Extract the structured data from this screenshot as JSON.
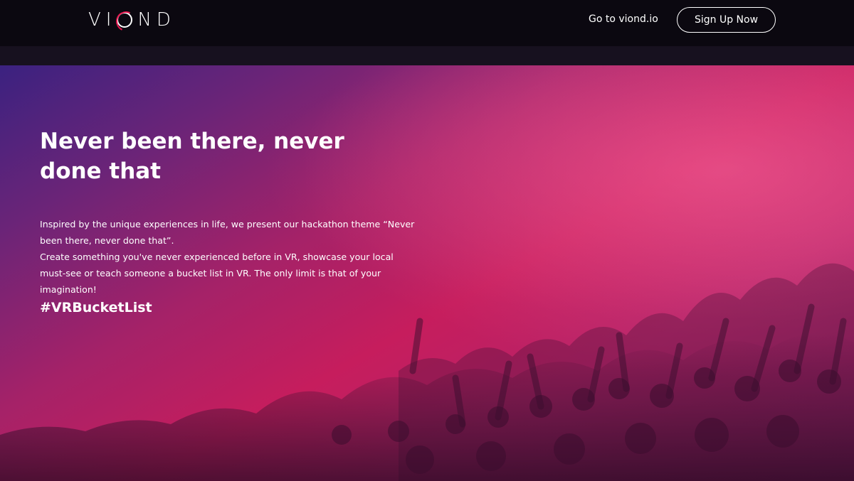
{
  "header": {
    "logo_text": "VIOND",
    "logo_prefix": "VI",
    "logo_suffix": "ND",
    "nav_link": "Go to viond.io",
    "signup_label": "Sign Up Now"
  },
  "hero": {
    "title": "Never been there, never done that",
    "paragraph_1": "Inspired by the unique experiences in life, we present our hackathon theme “Never been there, never done that”.",
    "paragraph_2": "Create something you've never experienced before in VR, showcase your local must-see or teach someone a bucket list in VR. The only limit is that of your imagination!",
    "hashtag": "#VRBucketList"
  },
  "colors": {
    "accent": "#e8154f",
    "header_bg": "#0b0810",
    "hero_pink": "#c61d5d",
    "hero_purple": "#3b2280"
  },
  "icons": {
    "logo_ring": "red-ring-logo-icon"
  }
}
